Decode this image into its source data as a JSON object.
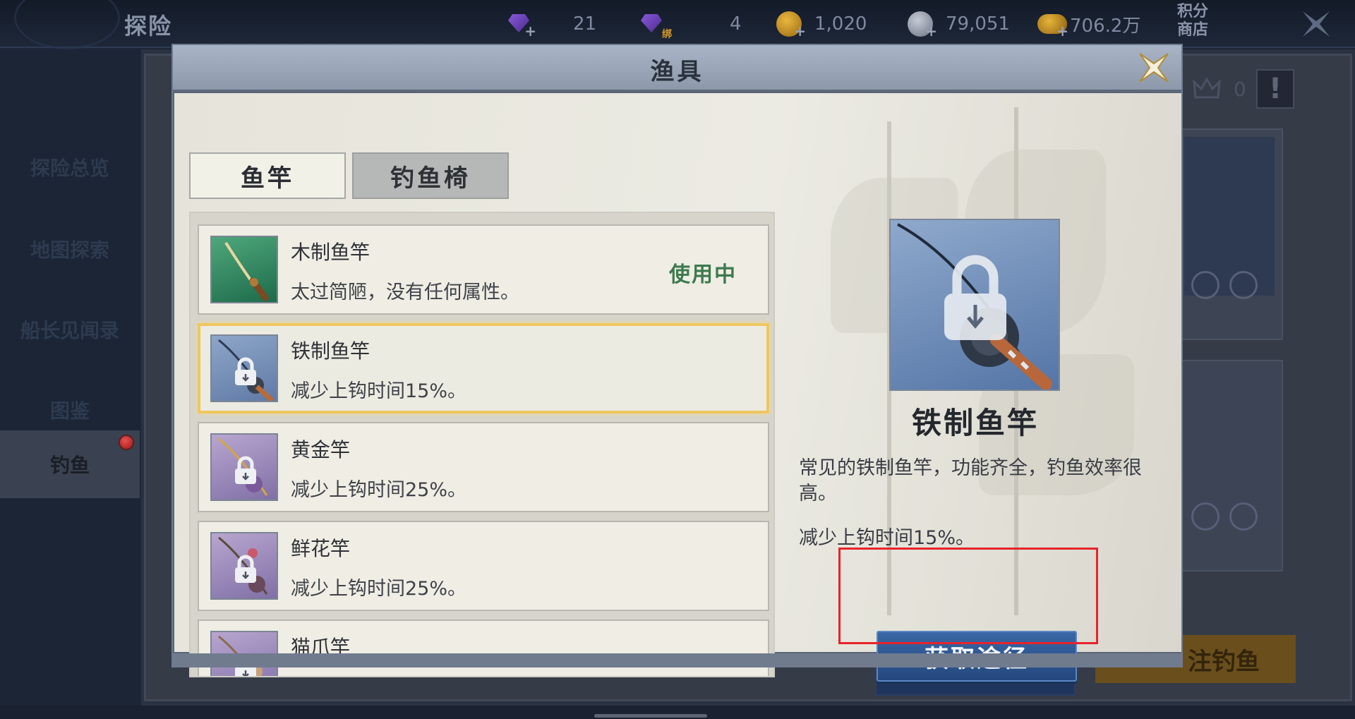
{
  "topbar": {
    "title": "探险",
    "resources": [
      {
        "icon": "purple-gem-icon",
        "value": "21",
        "badge": "+"
      },
      {
        "icon": "bound-gem-icon",
        "value": "4",
        "badge": "绑"
      },
      {
        "icon": "gold-coin-icon",
        "value": "1,020",
        "badge": "+"
      },
      {
        "icon": "silver-coin-icon",
        "value": "79,051",
        "badge": "+"
      },
      {
        "icon": "gold-stack-icon",
        "value": "706.2万",
        "badge": "+"
      }
    ],
    "shop_label_line1": "积分",
    "shop_label_line2": "商店"
  },
  "leftnav": {
    "items": [
      {
        "label": "探险总览"
      },
      {
        "label": "地图探索"
      },
      {
        "label": "船长见闻录"
      },
      {
        "label": "图鉴"
      },
      {
        "label": "钓鱼"
      }
    ],
    "active_index": 4
  },
  "background": {
    "crown_count": "0",
    "warn_label": "!",
    "go_fishing_label": "注钓鱼"
  },
  "modal": {
    "title": "渔具",
    "tabs": [
      {
        "label": "鱼竿",
        "active": true
      },
      {
        "label": "钓鱼椅",
        "active": false
      }
    ],
    "items": [
      {
        "name": "木制鱼竿",
        "desc": "太过简陋，没有任何属性。",
        "status": "使用中",
        "locked": false,
        "thumb": "green"
      },
      {
        "name": "铁制鱼竿",
        "desc": "减少上钩时间15%。",
        "locked": true,
        "selected": true,
        "thumb": "blue"
      },
      {
        "name": "黄金竿",
        "desc": "减少上钩时间25%。",
        "locked": true,
        "thumb": "purple"
      },
      {
        "name": "鲜花竿",
        "desc": "减少上钩时间25%。",
        "locked": true,
        "thumb": "purple"
      },
      {
        "name": "猫爪竿",
        "desc": "",
        "locked": true,
        "thumb": "purple"
      }
    ],
    "detail": {
      "name": "铁制鱼竿",
      "desc": "常见的铁制鱼竿，功能齐全，钓鱼效率很高。",
      "effect": "减少上钩时间15%。",
      "button": "获取途径"
    }
  },
  "colors": {
    "selected_border": "#efc760",
    "in_use_text": "#3c7a4e",
    "button_blue": "#2f5a96",
    "highlight_red": "#e8232a"
  }
}
